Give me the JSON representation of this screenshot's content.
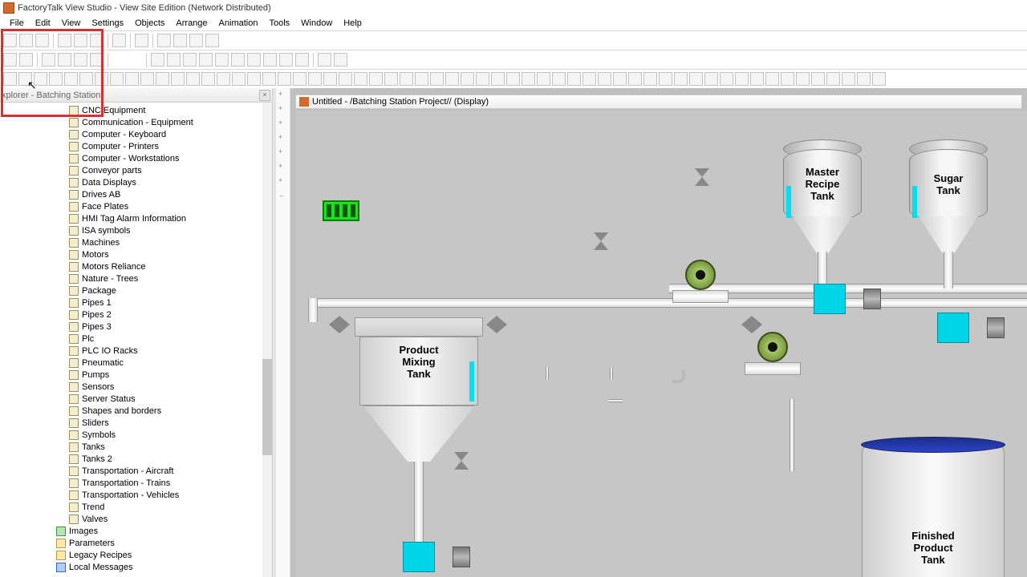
{
  "title": "FactoryTalk View Studio - View Site Edition (Network Distributed)",
  "menu": [
    "File",
    "Edit",
    "View",
    "Settings",
    "Objects",
    "Arrange",
    "Animation",
    "Tools",
    "Window",
    "Help"
  ],
  "explorer": {
    "header": "xplorer - Batching Station",
    "items": [
      "CNC Equipment",
      "Communication - Equipment",
      "Computer - Keyboard",
      "Computer - Printers",
      "Computer - Workstations",
      "Conveyor parts",
      "Data Displays",
      "Drives AB",
      "Face Plates",
      "HMI Tag Alarm Information",
      "ISA symbols",
      "Machines",
      "Motors",
      "Motors Reliance",
      "Nature - Trees",
      "Package",
      "Pipes 1",
      "Pipes 2",
      "Pipes 3",
      "Plc",
      "PLC IO Racks",
      "Pneumatic",
      "Pumps",
      "Sensors",
      "Server Status",
      "Shapes and borders",
      "Sliders",
      "Symbols",
      "Tanks",
      "Tanks 2",
      "Transportation - Aircraft",
      "Transportation - Trains",
      "Transportation - Vehicles",
      "Trend",
      "Valves"
    ],
    "l2": {
      "images": "Images",
      "parameters": "Parameters",
      "legacy": "Legacy Recipes",
      "local": "Local Messages"
    }
  },
  "canvas": {
    "title": "Untitled - /Batching Station Project// (Display)",
    "labels": {
      "master": "Master\nRecipe\nTank",
      "sugar": "Sugar\nTank",
      "mixing": "Product\nMixing\nTank",
      "finished": "Finished\nProduct\nTank"
    }
  }
}
